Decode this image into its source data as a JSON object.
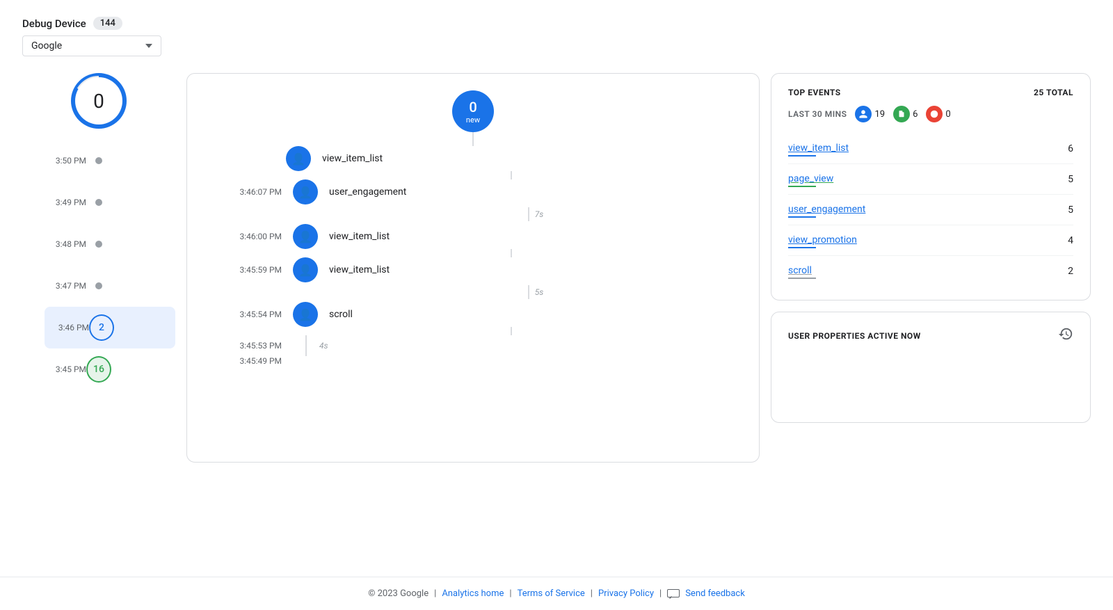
{
  "header": {
    "debug_label": "Debug Device",
    "debug_count": "144",
    "device_name": "Google"
  },
  "left_timeline": {
    "main_count": "0",
    "rows": [
      {
        "time": "3:50 PM",
        "type": "dot",
        "value": null
      },
      {
        "time": "3:49 PM",
        "type": "dot",
        "value": null
      },
      {
        "time": "3:48 PM",
        "type": "dot",
        "value": null
      },
      {
        "time": "3:47 PM",
        "type": "dot",
        "value": null
      },
      {
        "time": "3:46 PM",
        "type": "badge_blue",
        "value": "2"
      },
      {
        "time": "3:45 PM",
        "type": "badge_green",
        "value": "16"
      }
    ]
  },
  "mid_panel": {
    "top_circle_count": "0",
    "top_circle_label": "new",
    "events": [
      {
        "time": null,
        "name": "view_item_list",
        "gap": null
      },
      {
        "time": "3:46:07 PM",
        "name": "user_engagement",
        "gap": "7s"
      },
      {
        "time": "3:46:00 PM",
        "name": "view_item_list",
        "gap": null
      },
      {
        "time": "3:45:59 PM",
        "name": "view_item_list",
        "gap": "5s"
      },
      {
        "time": "3:45:54 PM",
        "name": "scroll",
        "gap": "4s"
      },
      {
        "time": "3:45:53 PM",
        "name": null,
        "gap": null
      },
      {
        "time": "3:45:49 PM",
        "name": null,
        "gap": null
      }
    ]
  },
  "top_events": {
    "title": "TOP EVENTS",
    "total_label": "25 TOTAL",
    "last_30_label": "LAST 30 MINS",
    "counts": {
      "blue": "19",
      "green": "6",
      "orange": "0"
    },
    "items": [
      {
        "name": "view_item_list",
        "count": "6",
        "underline_color": "#1a73e8"
      },
      {
        "name": "page_view",
        "count": "5",
        "underline_color": "#34a853"
      },
      {
        "name": "user_engagement",
        "count": "5",
        "underline_color": "#1a73e8"
      },
      {
        "name": "view_promotion",
        "count": "4",
        "underline_color": "#1a73e8"
      },
      {
        "name": "scroll",
        "count": "2",
        "underline_color": "#9aa0a6"
      }
    ]
  },
  "user_properties": {
    "title": "USER PROPERTIES ACTIVE NOW"
  },
  "footer": {
    "copyright": "© 2023 Google",
    "analytics_home": "Analytics home",
    "terms": "Terms of Service",
    "privacy": "Privacy Policy",
    "feedback": "Send feedback"
  }
}
